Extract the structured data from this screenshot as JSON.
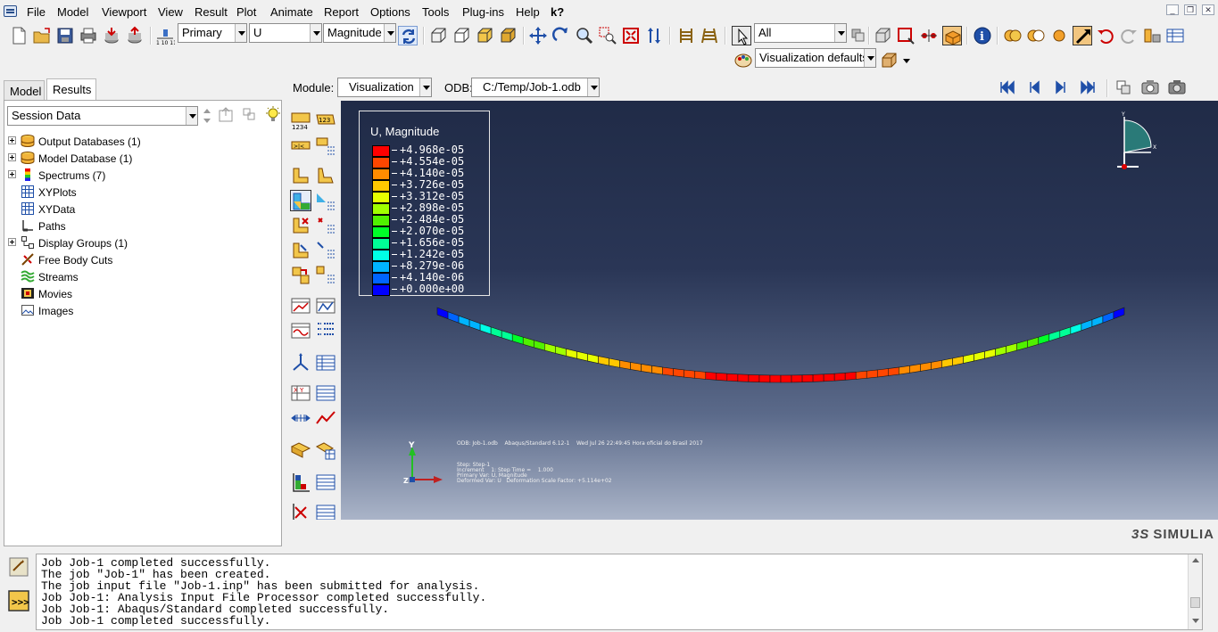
{
  "menu": [
    "File",
    "Model",
    "Viewport",
    "View",
    "Result",
    "Plot",
    "Animate",
    "Report",
    "Options",
    "Tools",
    "Plug-ins",
    "Help"
  ],
  "whatsthis": "k?",
  "toolbar": {
    "step_combo": "Primary",
    "var_combo": "U",
    "comp_combo": "Magnitude",
    "selection_combo": "All",
    "defaults_combo": "Visualization defaults"
  },
  "tabs": [
    "Model",
    "Results"
  ],
  "session_combo": "Session Data",
  "tree": [
    {
      "label": "Output Databases (1)",
      "expandable": true,
      "icon": "database-icon"
    },
    {
      "label": "Model Database (1)",
      "expandable": true,
      "icon": "database-icon"
    },
    {
      "label": "Spectrums (7)",
      "expandable": true,
      "icon": "spectrum-icon"
    },
    {
      "label": "XYPlots",
      "expandable": false,
      "icon": "grid-icon"
    },
    {
      "label": "XYData",
      "expandable": false,
      "icon": "grid-icon"
    },
    {
      "label": "Paths",
      "expandable": false,
      "icon": "path-icon"
    },
    {
      "label": "Display Groups (1)",
      "expandable": true,
      "icon": "display-group-icon"
    },
    {
      "label": "Free Body Cuts",
      "expandable": false,
      "icon": "free-body-icon"
    },
    {
      "label": "Streams",
      "expandable": false,
      "icon": "stream-icon"
    },
    {
      "label": "Movies",
      "expandable": false,
      "icon": "movie-icon"
    },
    {
      "label": "Images",
      "expandable": false,
      "icon": "image-icon"
    }
  ],
  "module": {
    "label": "Module:",
    "value": "Visualization",
    "odb_label": "ODB:",
    "odb_value": "C:/Temp/Job-1.odb"
  },
  "legend": {
    "title": "U, Magnitude",
    "entries": [
      {
        "value": "+4.968e-05",
        "color": "#ff0000"
      },
      {
        "value": "+4.554e-05",
        "color": "#ff4600"
      },
      {
        "value": "+4.140e-05",
        "color": "#ff8c00"
      },
      {
        "value": "+3.726e-05",
        "color": "#ffc800"
      },
      {
        "value": "+3.312e-05",
        "color": "#e6ff00"
      },
      {
        "value": "+2.898e-05",
        "color": "#a0ff00"
      },
      {
        "value": "+2.484e-05",
        "color": "#50f000"
      },
      {
        "value": "+2.070e-05",
        "color": "#00ff28"
      },
      {
        "value": "+1.656e-05",
        "color": "#00ff96"
      },
      {
        "value": "+1.242e-05",
        "color": "#00ffe6"
      },
      {
        "value": "+8.279e-06",
        "color": "#00b4ff"
      },
      {
        "value": "+4.140e-06",
        "color": "#0064ff"
      },
      {
        "value": "+0.000e+00",
        "color": "#0000ff"
      }
    ]
  },
  "viewport_info": {
    "line1": "ODB: Job-1.odb    Abaqus/Standard 6.12-1    Wed Jul 26 22:49:45 Hora oficial do Brasil 2017",
    "line2": "Step: Step-1",
    "line3": "Increment    1: Step Time =    1.000",
    "line4": "Primary Var: U, Magnitude",
    "line5": "Deformed Var: U   Deformation Scale Factor: +5.114e+02"
  },
  "triad": {
    "y": "Y",
    "z": "Z",
    "x": "X"
  },
  "brand": "SIMULIA",
  "messages": [
    "Job Job-1 completed successfully.",
    "The job \"Job-1\" has been created.",
    "The job input file \"Job-1.inp\" has been submitted for analysis.",
    "Job Job-1: Analysis Input File Processor completed successfully.",
    "Job Job-1: Abaqus/Standard completed successfully.",
    "Job Job-1 completed successfully."
  ]
}
